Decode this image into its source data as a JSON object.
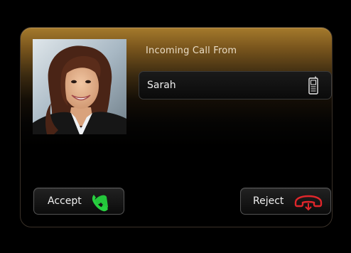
{
  "call": {
    "title": "Incoming Call From",
    "caller_name": "Sarah",
    "caller_icon": "mobile-phone-icon",
    "photo": "caller-photo-avatar"
  },
  "actions": {
    "accept_label": "Accept",
    "accept_icon": "phone-handset-icon",
    "reject_label": "Reject",
    "reject_icon": "hang-up-icon"
  },
  "colors": {
    "accent": "#a57a2c",
    "accept": "#22c33a",
    "reject": "#d8262a",
    "background": "#000000"
  }
}
